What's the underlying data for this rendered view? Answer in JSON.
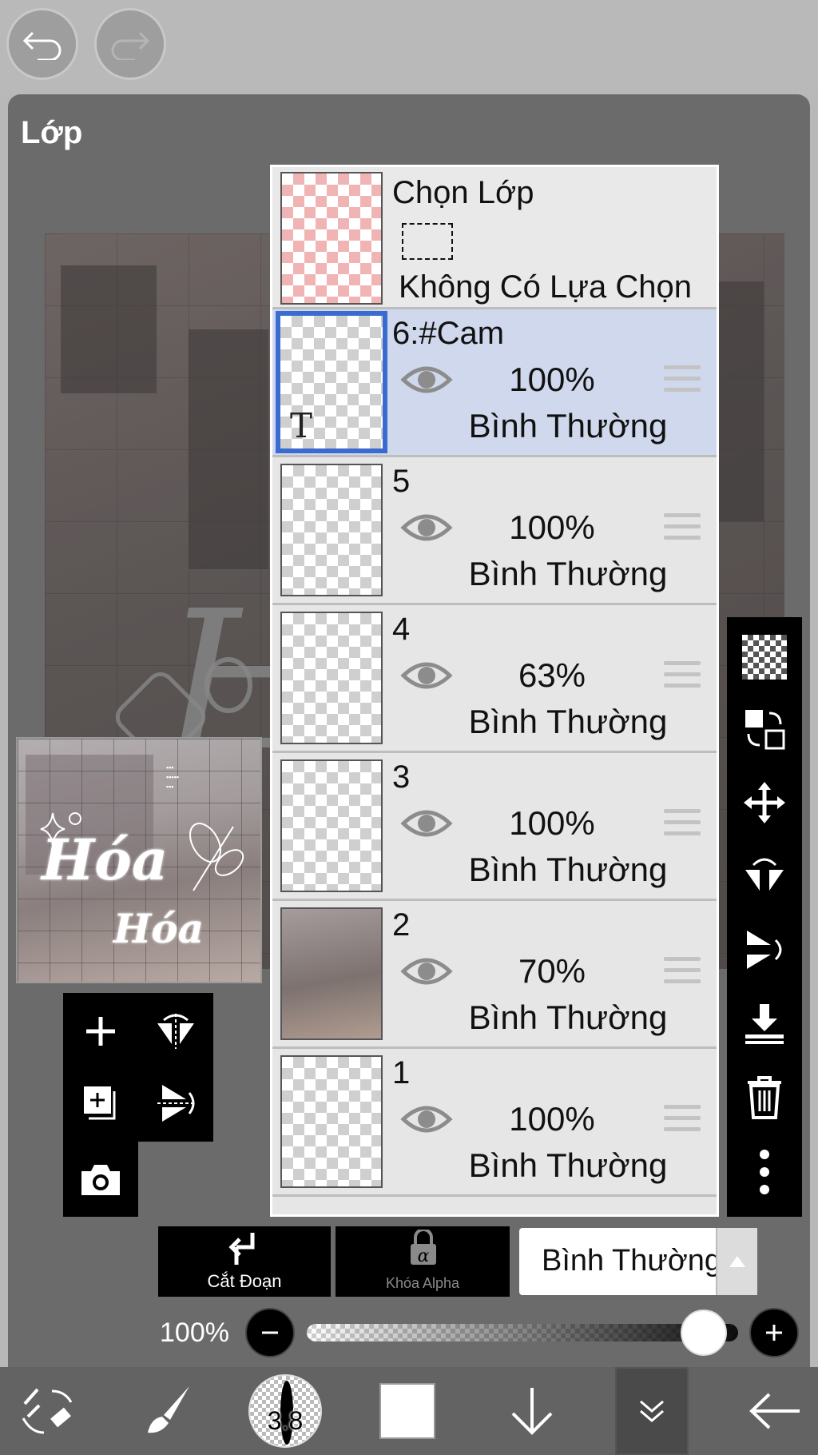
{
  "panel": {
    "title": "Lớp"
  },
  "selection_layer": {
    "name": "Chọn Lớp",
    "status": "Không Có Lựa Chọn"
  },
  "layers": [
    {
      "name": "6:#Cam",
      "opacity": "100%",
      "blend": "Bình Thường",
      "active": true,
      "type_icon": "T"
    },
    {
      "name": "5",
      "opacity": "100%",
      "blend": "Bình Thường",
      "active": false
    },
    {
      "name": "4",
      "opacity": "63%",
      "blend": "Bình Thường",
      "active": false
    },
    {
      "name": "3",
      "opacity": "100%",
      "blend": "Bình Thường",
      "active": false
    },
    {
      "name": "2",
      "opacity": "70%",
      "blend": "Bình Thường",
      "active": false
    },
    {
      "name": "1",
      "opacity": "100%",
      "blend": "Bình Thường",
      "active": false
    }
  ],
  "actions": {
    "clip_label": "Cắt Đoạn",
    "alpha_lock_label": "Khóa Alpha",
    "blend_mode": "Bình Thường"
  },
  "opacity_slider": {
    "label": "100%",
    "value": 1.0
  },
  "brush": {
    "size": "3.8"
  },
  "colors": {
    "active_border": "#3a6bd0",
    "active_row": "#cfd8ec",
    "panel_bg": "#6b6b6b"
  },
  "preview": {
    "text_main": "Hóa",
    "text_sub": "Hóa"
  },
  "icons": {
    "top": [
      "undo-icon",
      "redo-icon"
    ],
    "left_tools": [
      "add-layer-icon",
      "flip-horizontal-icon",
      "copy-layer-icon",
      "flip-vertical-icon",
      "camera-icon"
    ],
    "right_tools": [
      "transparent-layer-icon",
      "swap-layer-icon",
      "move-icon",
      "rotate-flip-icon",
      "flip-vertical-rotate-icon",
      "merge-down-icon",
      "trash-icon",
      "more-icon"
    ],
    "bottom_nav": [
      "transform-icon",
      "brush-icon",
      "brush-size-icon",
      "color-swatch-icon",
      "arrow-down-icon",
      "layers-collapse-icon",
      "back-arrow-icon"
    ]
  }
}
